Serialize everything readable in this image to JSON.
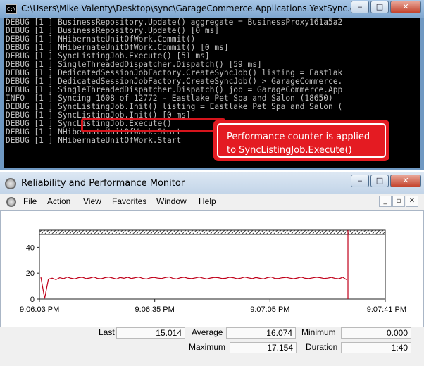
{
  "console": {
    "icon_text": "C:\\",
    "title": "C:\\Users\\Mike Valenty\\Desktop\\sync\\GarageCommerce.Applications.YextSync.exe",
    "lines": [
      "DEBUG [1 ] BusinessRepository.Update() aggregate = BusinessProxy161a5a2",
      "DEBUG [1 ] BusinessRepository.Update() [0 ms]",
      "DEBUG [1 ] NHibernateUnitOfWork.Commit()",
      "DEBUG [1 ] NHibernateUnitOfWork.Commit() [0 ms]",
      "DEBUG [1 ] SyncListingJob.Execute() [51 ms]",
      "DEBUG [1 ] SingleThreadedDispatcher.Dispatch() [59 ms]",
      "DEBUG [1 ] DedicatedSessionJobFactory.CreateSyncJob() listing = Eastlak",
      "DEBUG [1 ] DedicatedSessionJobFactory.CreateSyncJob() > GarageCommerce.",
      "DEBUG [1 ] SingleThreadedDispatcher.Dispatch() job = GarageCommerce.App",
      "INFO  [1 ] Syncing 1608 of 12772 - Eastlake Pet Spa and Salon (18650)",
      "DEBUG [1 ] SyncListingJob.Init() listing = Eastlake Pet Spa and Salon (",
      "DEBUG [1 ] SyncListingJob.Init() [0 ms]",
      "DEBUG [1 ] SyncListingJob.Execute()",
      "DEBUG [1 ] NHibernateUnitOfWork.Start",
      "DEBUG [1 ] NHibernateUnitOfWork.Start                           k.NHib"
    ],
    "callout": "Performance counter is applied to SyncListingJob.Execute()",
    "buttons": {
      "minimize": "‒",
      "maximize": "□",
      "close": "✕"
    }
  },
  "perfmon": {
    "title": "Reliability and Performance Monitor",
    "menu": [
      "File",
      "Action",
      "View",
      "Favorites",
      "Window",
      "Help"
    ],
    "title_buttons": {
      "minimize": "‒",
      "maximize": "□",
      "close": "✕"
    },
    "mdi_buttons": {
      "minimize": "_",
      "restore": "▫",
      "close": "✕"
    },
    "stats": {
      "last_label": "Last",
      "last": "15.014",
      "average_label": "Average",
      "average": "16.074",
      "minimum_label": "Minimum",
      "minimum": "0.000",
      "maximum_label": "Maximum",
      "maximum": "17.154",
      "duration_label": "Duration",
      "duration": "1:40"
    }
  },
  "chart_data": {
    "type": "line",
    "ylim": [
      0,
      50
    ],
    "yticks": [
      "40",
      "20",
      "0"
    ],
    "ytick_values": [
      40,
      20,
      0
    ],
    "xtick_labels": [
      "9:06:03 PM",
      "9:06:35 PM",
      "9:07:05 PM",
      "9:07:41 PM"
    ],
    "grid": false,
    "line_color": "#c0001a",
    "series": [
      {
        "x": [
          0,
          1,
          2,
          3,
          4,
          5,
          6,
          7,
          8,
          9,
          10,
          11,
          12,
          13,
          14,
          15,
          16,
          17,
          18,
          19,
          20,
          21,
          22,
          23,
          24,
          25,
          26,
          27,
          28,
          29,
          30,
          31,
          32,
          33,
          34,
          35,
          36,
          37,
          38,
          39,
          40,
          41,
          42,
          43,
          44,
          45,
          46,
          47,
          48,
          49,
          50,
          51,
          52,
          53,
          54,
          55,
          56,
          57,
          58,
          59,
          60,
          61,
          62,
          63,
          64,
          65,
          66,
          67,
          68,
          69,
          70,
          71,
          72,
          73,
          74,
          75,
          76,
          77,
          78,
          79,
          80,
          81
        ],
        "values": [
          17.0,
          0.5,
          15.4,
          16.2,
          15.0,
          16.5,
          15.8,
          17.0,
          16.1,
          15.6,
          16.6,
          16.9,
          15.8,
          16.3,
          17.1,
          16.0,
          15.7,
          16.6,
          17.0,
          16.3,
          15.5,
          16.7,
          16.1,
          16.9,
          15.9,
          16.6,
          17.0,
          16.0,
          15.5,
          16.4,
          16.8,
          16.2,
          15.9,
          16.7,
          17.1,
          16.0,
          15.6,
          16.5,
          16.9,
          16.1,
          15.8,
          16.4,
          17.0,
          16.2,
          15.6,
          16.3,
          16.8,
          16.6,
          15.9,
          16.1,
          16.9,
          16.5,
          15.7,
          16.2,
          17.0,
          16.4,
          15.8,
          16.7,
          16.1,
          15.6,
          16.6,
          17.1,
          16.0,
          15.9,
          16.5,
          16.8,
          16.2,
          15.7,
          16.3,
          17.0,
          16.1,
          15.8,
          16.4,
          16.9,
          16.6,
          15.9,
          16.2,
          16.8,
          16.0,
          15.7,
          16.9,
          15.0
        ]
      }
    ]
  }
}
